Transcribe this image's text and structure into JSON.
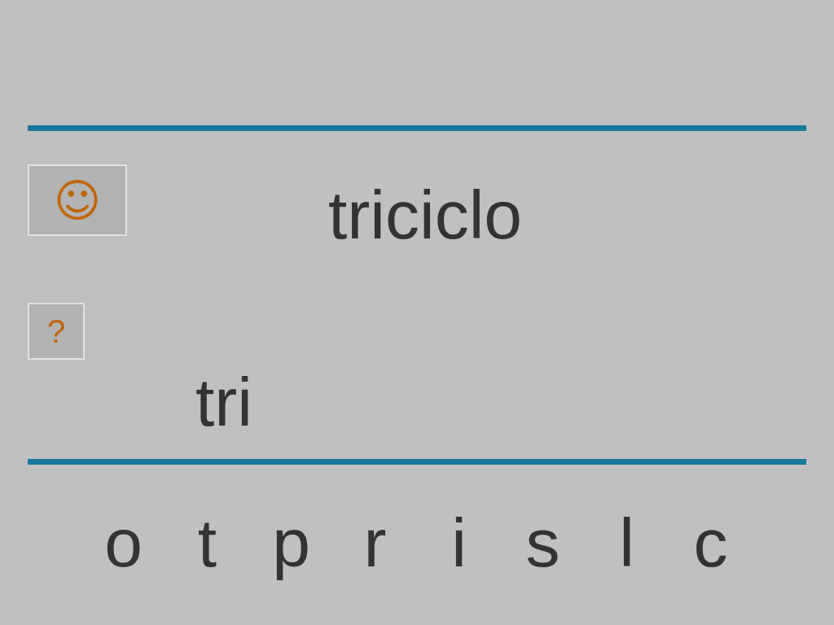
{
  "smiley_button": {
    "label": "☺"
  },
  "word": "triciclo",
  "help_button": {
    "label": "?"
  },
  "answer": "tri",
  "letters": [
    "o",
    "t",
    "p",
    "r",
    "i",
    "s",
    "l",
    "c"
  ]
}
